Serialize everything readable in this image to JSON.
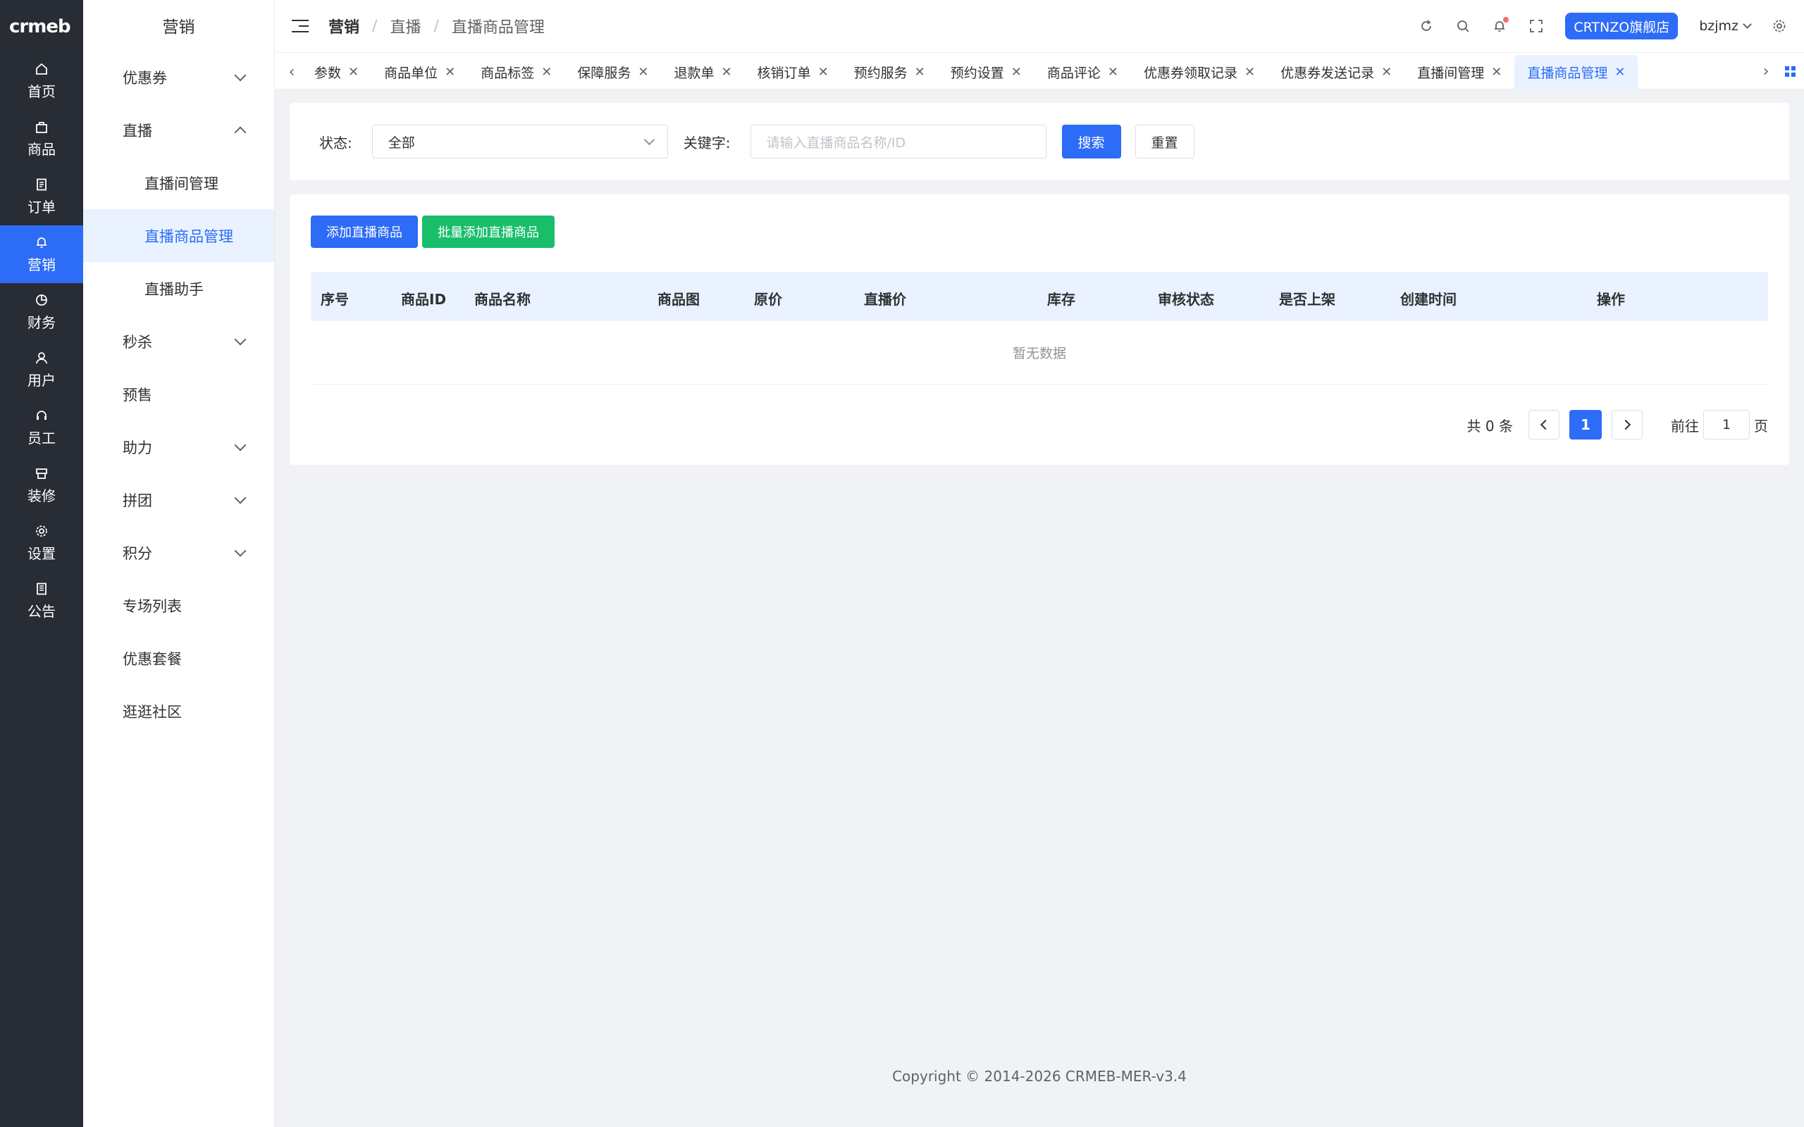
{
  "rail": {
    "logo": "crmeb",
    "items": [
      {
        "label": "首页",
        "icon": "home-icon"
      },
      {
        "label": "商品",
        "icon": "bag-icon"
      },
      {
        "label": "订单",
        "icon": "order-icon"
      },
      {
        "label": "营销",
        "icon": "bell-icon"
      },
      {
        "label": "财务",
        "icon": "pie-icon"
      },
      {
        "label": "用户",
        "icon": "user-icon"
      },
      {
        "label": "员工",
        "icon": "headset-icon"
      },
      {
        "label": "装修",
        "icon": "decorate-icon"
      },
      {
        "label": "设置",
        "icon": "gear-icon"
      },
      {
        "label": "公告",
        "icon": "notice-icon"
      }
    ],
    "active_index": 3
  },
  "submenu": {
    "title": "营销",
    "items": [
      {
        "label": "优惠券"
      },
      {
        "label": "直播"
      },
      {
        "label": "直播间管理"
      },
      {
        "label": "直播商品管理"
      },
      {
        "label": "直播助手"
      },
      {
        "label": "秒杀"
      },
      {
        "label": "预售"
      },
      {
        "label": "助力"
      },
      {
        "label": "拼团"
      },
      {
        "label": "积分"
      },
      {
        "label": "专场列表"
      },
      {
        "label": "优惠套餐"
      },
      {
        "label": "逛逛社区"
      }
    ]
  },
  "header": {
    "breadcrumb": [
      "营销",
      "直播",
      "直播商品管理"
    ],
    "separator": "/",
    "store_button": "CRTNZO旗舰店",
    "username": "bzjmz"
  },
  "tabs": [
    {
      "label": "参数"
    },
    {
      "label": "商品单位"
    },
    {
      "label": "商品标签"
    },
    {
      "label": "保障服务"
    },
    {
      "label": "退款单"
    },
    {
      "label": "核销订单"
    },
    {
      "label": "预约服务"
    },
    {
      "label": "预约设置"
    },
    {
      "label": "商品评论"
    },
    {
      "label": "优惠券领取记录"
    },
    {
      "label": "优惠券发送记录"
    },
    {
      "label": "直播间管理"
    },
    {
      "label": "直播商品管理"
    }
  ],
  "filter": {
    "status_label": "状态:",
    "status_value": "全部",
    "keyword_label": "关键字:",
    "keyword_placeholder": "请输入直播商品名称/ID",
    "search_button": "搜索",
    "reset_button": "重置"
  },
  "actions": {
    "add_button": "添加直播商品",
    "batch_add_button": "批量添加直播商品"
  },
  "table": {
    "columns": [
      "序号",
      "商品ID",
      "商品名称",
      "商品图",
      "原价",
      "直播价",
      "库存",
      "审核状态",
      "是否上架",
      "创建时间",
      "操作"
    ],
    "empty_text": "暂无数据"
  },
  "pagination": {
    "total_text": "共 0 条",
    "current_page": "1",
    "goto_label": "前往",
    "goto_value": "1",
    "page_suffix": "页"
  },
  "footer": {
    "copyright": "Copyright © 2014-2026 CRMEB-MER-v3.4"
  },
  "colors": {
    "primary": "#2d6cf6",
    "success": "#19be6b",
    "rail_bg": "#282c34",
    "page_bg": "#f0f2f5"
  }
}
